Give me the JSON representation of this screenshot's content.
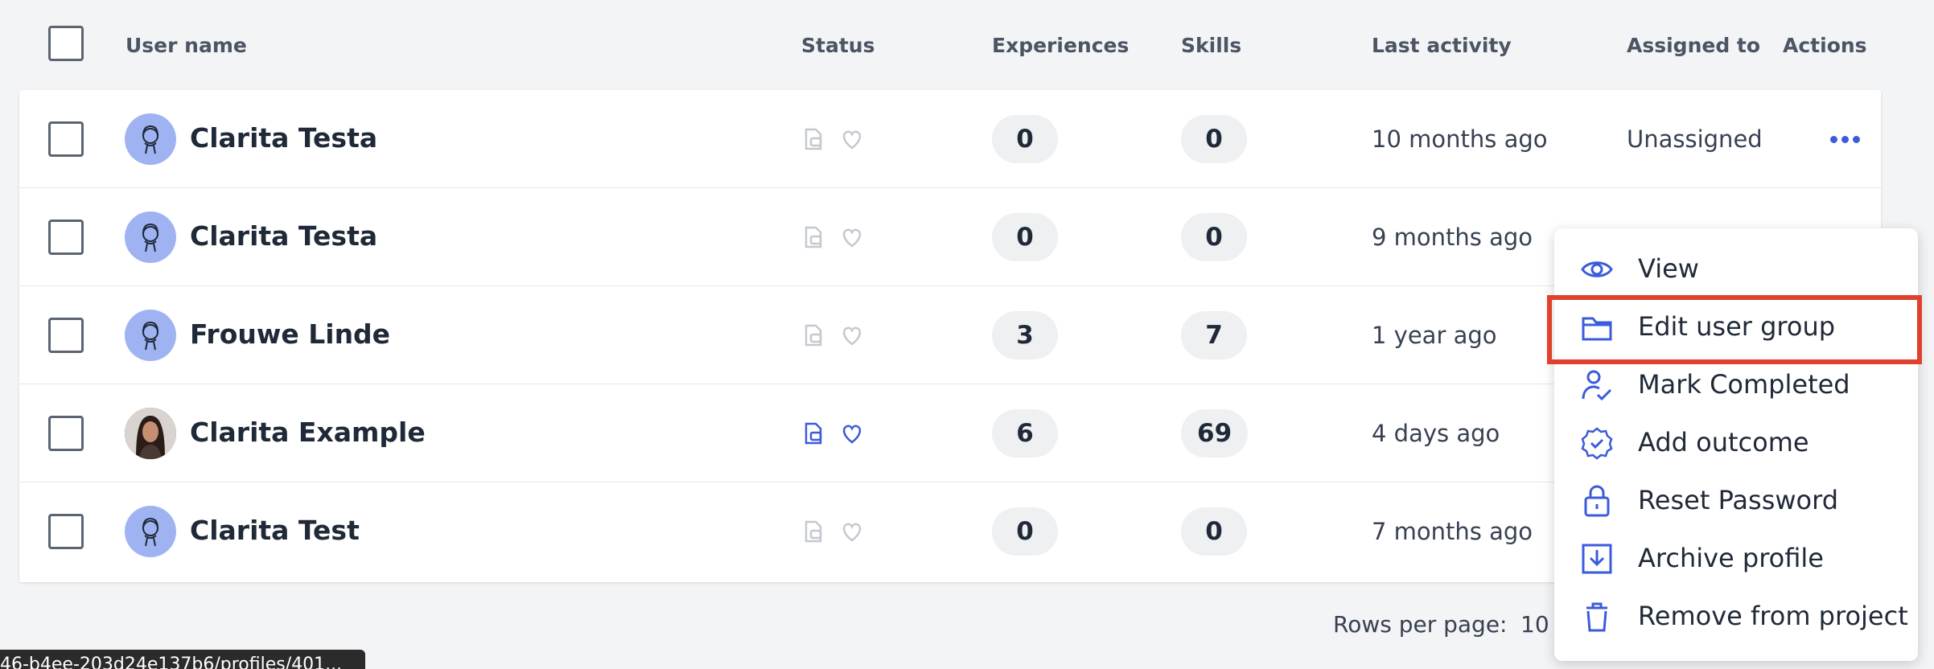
{
  "header": {
    "user_name": "User name",
    "status": "Status",
    "experiences": "Experiences",
    "skills": "Skills",
    "last_activity": "Last activity",
    "assigned_to": "Assigned to",
    "actions": "Actions"
  },
  "rows": [
    {
      "name": "Clarita Testa",
      "avatar": "placeholder-avatar-icon",
      "status_active": false,
      "experiences": "0",
      "skills": "0",
      "last_activity": "10 months ago",
      "assigned_to": "Unassigned"
    },
    {
      "name": "Clarita Testa",
      "avatar": "placeholder-avatar-icon",
      "status_active": false,
      "experiences": "0",
      "skills": "0",
      "last_activity": "9 months ago",
      "assigned_to": ""
    },
    {
      "name": "Frouwe Linde",
      "avatar": "placeholder-avatar-icon",
      "status_active": false,
      "experiences": "3",
      "skills": "7",
      "last_activity": "1 year ago",
      "assigned_to": ""
    },
    {
      "name": "Clarita Example",
      "avatar": "photo-avatar",
      "status_active": true,
      "experiences": "6",
      "skills": "69",
      "last_activity": "4 days ago",
      "assigned_to": ""
    },
    {
      "name": "Clarita Test",
      "avatar": "placeholder-avatar-icon",
      "status_active": false,
      "experiences": "0",
      "skills": "0",
      "last_activity": "7 months ago",
      "assigned_to": ""
    }
  ],
  "pagination": {
    "rows_per_page_label": "Rows per page:",
    "rows_per_page_value": "10"
  },
  "status_bar": {
    "url_text": "46-b4ee-203d24e137b6/profiles/401..."
  },
  "menu": {
    "items": [
      {
        "label": "View",
        "icon": "eye-icon"
      },
      {
        "label": "Edit user group",
        "icon": "folder-icon"
      },
      {
        "label": "Mark Completed",
        "icon": "user-check-icon"
      },
      {
        "label": "Add outcome",
        "icon": "badge-check-icon"
      },
      {
        "label": "Reset Password",
        "icon": "lock-icon"
      },
      {
        "label": "Archive profile",
        "icon": "archive-download-icon"
      },
      {
        "label": "Remove from project",
        "icon": "trash-icon"
      }
    ],
    "highlighted_item": "Edit user group"
  },
  "colors": {
    "accent": "#3b5bdb",
    "highlight": "#e0412c",
    "inactive_icon": "#c4c8cf"
  }
}
